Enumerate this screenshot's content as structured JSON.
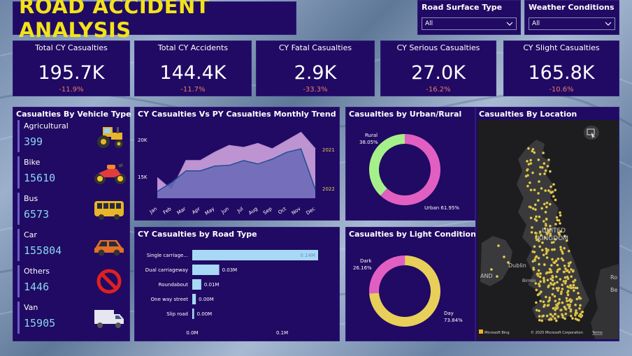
{
  "title": "ROAD ACCIDENT ANALYSIS",
  "slicers": [
    {
      "label": "Road Surface Type",
      "value": "All"
    },
    {
      "label": "Weather Conditions",
      "value": "All"
    }
  ],
  "kpis": [
    {
      "title": "Total CY Casualties",
      "value": "195.7K",
      "change": "-11.9%"
    },
    {
      "title": "Total CY Accidents",
      "value": "144.4K",
      "change": "-11.7%"
    },
    {
      "title": "CY Fatal Casualties",
      "value": "2.9K",
      "change": "-33.3%"
    },
    {
      "title": "CY Serious Casualties",
      "value": "27.0K",
      "change": "-16.2%"
    },
    {
      "title": "CY Slight Casualties",
      "value": "165.8K",
      "change": "-10.6%"
    }
  ],
  "vehicle": {
    "title": "Casualties By Vehicle Type",
    "items": [
      {
        "name": "Agricultural",
        "value": "399",
        "icon": "tractor-icon"
      },
      {
        "name": "Bike",
        "value": "15610",
        "icon": "motorbike-icon"
      },
      {
        "name": "Bus",
        "value": "6573",
        "icon": "bus-icon"
      },
      {
        "name": "Car",
        "value": "155804",
        "icon": "car-icon"
      },
      {
        "name": "Others",
        "value": "1446",
        "icon": "prohibited-icon"
      },
      {
        "name": "Van",
        "value": "15905",
        "icon": "van-icon"
      }
    ]
  },
  "trend": {
    "title": "CY Casualties Vs PY Casualties Monthly Trend",
    "yticks": [
      "20K",
      "15K"
    ],
    "months": [
      "Jan",
      "Feb",
      "Mar",
      "Apr",
      "May",
      "Jun",
      "Jul",
      "Aug",
      "Sep",
      "Oct",
      "Nov",
      "Dec"
    ],
    "series_labels": [
      "2021",
      "2022"
    ]
  },
  "chart_data": [
    {
      "type": "area",
      "title": "CY Casualties Vs PY Casualties Monthly Trend",
      "categories": [
        "Jan",
        "Feb",
        "Mar",
        "Apr",
        "May",
        "Jun",
        "Jul",
        "Aug",
        "Sep",
        "Oct",
        "Nov",
        "Dec"
      ],
      "series": [
        {
          "name": "2021",
          "values": [
            15500,
            13700,
            18000,
            18000,
            19200,
            20200,
            19900,
            20500,
            19700,
            20900,
            22100,
            19700
          ]
        },
        {
          "name": "2022",
          "values": [
            13500,
            14800,
            16500,
            16500,
            17200,
            17300,
            18000,
            17500,
            18200,
            19200,
            19700,
            13800
          ]
        }
      ],
      "ylim": [
        12500,
        23500
      ]
    },
    {
      "type": "pie",
      "title": "Casualties by Urban/Rural",
      "labels": [
        "Rural",
        "Urban"
      ],
      "values": [
        38.05,
        61.95
      ],
      "value_labels": [
        "38.05%",
        "Urban 61.95%"
      ],
      "colors": [
        "#a6f08a",
        "#e25fc2"
      ]
    },
    {
      "type": "bar",
      "title": "CY Casualties by Road Type",
      "categories": [
        "Single carriage...",
        "Dual carriageway",
        "Roundabout",
        "One way street",
        "Slip road"
      ],
      "values": [
        0.14,
        0.03,
        0.01,
        0.004,
        0.002
      ],
      "value_labels": [
        "0.14M",
        "0.03M",
        "0.01M",
        "0.00M",
        "0.00M"
      ],
      "xticks": [
        "0.0M",
        "0.1M"
      ],
      "xlim": [
        0,
        0.14
      ]
    },
    {
      "type": "pie",
      "title": "Casualties by Light Conditions",
      "labels": [
        "Dark",
        "Day"
      ],
      "values": [
        26.16,
        73.84
      ],
      "value_labels": [
        "26.16%",
        "73.84%"
      ],
      "colors": [
        "#e25fc2",
        "#e8cf5a"
      ]
    }
  ],
  "road": {
    "title": "CY Casualties by Road Type",
    "labels": [
      "Single carriage...",
      "Dual carriageway",
      "Roundabout",
      "One way street",
      "Slip road"
    ],
    "values": [
      "0.14M",
      "0.03M",
      "0.01M",
      "0.00M",
      "0.00M"
    ],
    "xticks": [
      "0.0M",
      "0.1M"
    ]
  },
  "urban": {
    "title": "Casualties by Urban/Rural",
    "rural_label": "Rural",
    "rural_value": "38.05%",
    "urban_label": "Urban 61.95%"
  },
  "light": {
    "title": "Casualties by Light Conditions",
    "dark_label": "Dark",
    "dark_value": "26.16%",
    "day_label": "Day",
    "day_value": "73.84%"
  },
  "map": {
    "title": "Casualties By Location",
    "labels": [
      "UNITED",
      "KINGDOM",
      "Dublin",
      "AND",
      "Birmin",
      "Ro",
      "Be"
    ],
    "footer_left": "Microsoft Bing",
    "footer_right": "© 2025 Microsoft Corporation",
    "terms": "Terms"
  },
  "colors": {
    "panel": "#200a63",
    "title_yellow": "#f2e21a",
    "change_red": "#f07a6a",
    "value_blue": "#8bd4f0",
    "area_cy": "#c79bd8",
    "area_py": "#6d6bb8",
    "bar": "#a8d8f5"
  }
}
